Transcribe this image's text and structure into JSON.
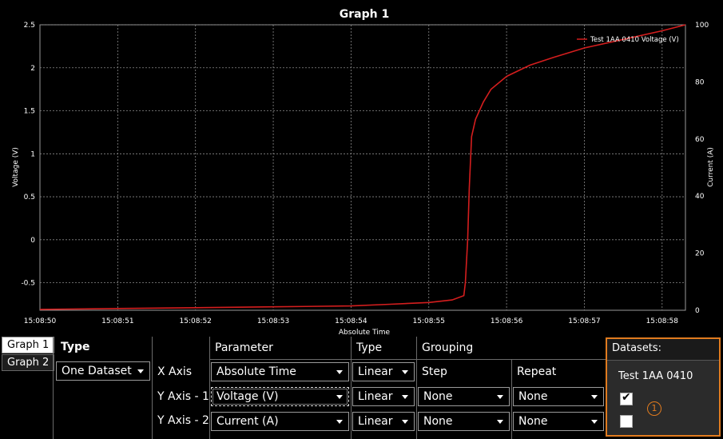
{
  "graph": {
    "title": "Graph 1",
    "legend_label": "Test 1AA 0410 Voltage (V)",
    "colors": {
      "background": "#000000",
      "grid": "#8a8a8a",
      "series": "#d41e1e"
    },
    "chart_data": {
      "type": "line",
      "x_label": "Absolute Time",
      "y_label": "Voltage (V)",
      "y2_label": "Current (A)",
      "x_ticks": [
        "15:08:50",
        "15:08:51",
        "15:08:52",
        "15:08:53",
        "15:08:54",
        "15:08:55",
        "15:08:56",
        "15:08:57",
        "15:08:58"
      ],
      "x_range_seconds_after_15_08_50": [
        0,
        8.3
      ],
      "y_ticks": [
        "-0.5",
        "0",
        "0.5",
        "1",
        "1.5",
        "2",
        "2.5"
      ],
      "y_range": [
        -0.82,
        2.5
      ],
      "y2_ticks": [
        "0",
        "20",
        "40",
        "60",
        "80",
        "100"
      ],
      "y2_range": [
        0,
        100
      ],
      "series": [
        {
          "name": "Test 1AA 0410 Voltage (V)",
          "axis": "left",
          "points": [
            [
              0.0,
              -0.81
            ],
            [
              1.0,
              -0.8
            ],
            [
              2.0,
              -0.79
            ],
            [
              3.0,
              -0.78
            ],
            [
              4.0,
              -0.77
            ],
            [
              4.5,
              -0.75
            ],
            [
              5.0,
              -0.73
            ],
            [
              5.3,
              -0.7
            ],
            [
              5.45,
              -0.65
            ],
            [
              5.47,
              -0.5
            ],
            [
              5.5,
              0.0
            ],
            [
              5.52,
              0.6
            ],
            [
              5.55,
              1.2
            ],
            [
              5.6,
              1.4
            ],
            [
              5.7,
              1.6
            ],
            [
              5.8,
              1.75
            ],
            [
              6.0,
              1.9
            ],
            [
              6.3,
              2.03
            ],
            [
              6.6,
              2.12
            ],
            [
              7.0,
              2.23
            ],
            [
              7.5,
              2.33
            ],
            [
              8.0,
              2.43
            ],
            [
              8.3,
              2.5
            ]
          ]
        }
      ]
    }
  },
  "tabs": [
    {
      "label": "Graph 1",
      "active": true
    },
    {
      "label": "Graph 2",
      "active": false
    }
  ],
  "settings": {
    "type_header": "Type",
    "type_value": "One Dataset",
    "row_labels": [
      "X Axis",
      "Y Axis - 1",
      "Y Axis - 2"
    ],
    "col_headers": {
      "parameter": "Parameter",
      "type": "Type",
      "grouping": "Grouping"
    },
    "step_label": "Step",
    "repeat_label": "Repeat",
    "parameters": [
      "Absolute Time",
      "Voltage (V)",
      "Current (A)"
    ],
    "axis_types": [
      "Linear",
      "Linear",
      "Linear"
    ],
    "steps": [
      "None",
      "None"
    ],
    "repeats": [
      "None",
      "None"
    ]
  },
  "datasets": {
    "header": "Datasets:",
    "name": "Test 1AA 0410",
    "checks": [
      true,
      false
    ],
    "marker": "1"
  }
}
